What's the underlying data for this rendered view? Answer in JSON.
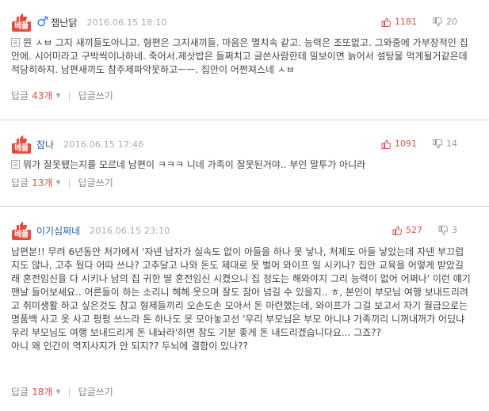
{
  "best_label": "베플",
  "comments": [
    {
      "gender_symbol": "♂",
      "nickname": "잼난닭",
      "date": "2016.06.15 18:10",
      "up": "1181",
      "down": "20",
      "text": "뭔 ㅅㅂ 그지 새끼들도아니고. 형편은 그지새끼들. 마음은 멸치속 같고. 능력은 조또없고. 그와중에 가부장적인 집안에. 시어미라고 구박씩이나하네. 죽어서.제삿밥은 들쩌치고 글쓴사람한테 밀보이면 늙어서 설탕물 먹게될거같은데 적당히하지. 남편새끼도 참주제파악못하고ㅡㅡ. 집안이 어쩐져스네 ㅅㅂ",
      "reply_label": "답글",
      "reply_count": "43개",
      "arrow": "▼",
      "write_label": "답글쓰기",
      "thumb_icon": "thumbs-up-icon",
      "up_icon": "thumbs-up-icon",
      "down_icon": "thumbs-down-icon"
    },
    {
      "nickname": "참나",
      "date": "2016.06.15 17:46",
      "up": "1091",
      "down": "14",
      "text": "뭐가 잘못됐는지를 모르네 남편이 ㅋㅋㅋ 니네 가족이 잘못된거야.. 부인 말투가 아니라",
      "reply_label": "답글",
      "reply_count": "13개",
      "arrow": "▼",
      "write_label": "답글쓰기"
    },
    {
      "nickname": "이기심쩌네",
      "date": "2016.06.15 23:10",
      "up": "527",
      "down": "3",
      "text": "남편분!! 무려 6년동안 처가에서 '자넨 남자가 실속도 없이 아들을 하나 못 낳나, 처제도 아들 낳았는데 자넨 부끄럽지도 않나, 고추 뒀다 어따 쓰나? 고추달고 나와 돈도 제대로 못 벌어 와이프 일 시키나? 집안 교육을 어떻게 받았길래 혼전임신을 다 시키나 남의 집 귀한 딸 혼전임신 시켰으니 집 정도는 해와야지 그리 능력이 없어 어쩌나' 이런 얘기 맨날 들어보세요.. 어른들이 하는 소리니 헤헤 웃으며 잘도 참아 넘길 수 있을지.. ㅎ, 본인이 부모님 여행 보내드리려고 취미생활 하고 싶은것도 참고 형제들끼리 오손도손 모아서 돈 마련했는데, 와이프가 그걸 보고서 자기 월급으로는 명품백 사고 옷 사고 펑펑 쓰느라 돈 하나도 못 모아놓고선 '우리 부모님은 부모 아니냐 가족끼리 니꺼내꺼가 어딨냐 우리 부모님도 여행 보내드리게 돈 내놔라'하면 참도 기분 좋게 돈 내드리겠습니다요... 그죠??\n아니 왜 인간이 역지사지가 안 되지?? 두뇌에 결함이 있나??",
      "reply_label": "답글",
      "reply_count": "18개",
      "arrow": "▼",
      "write_label": "답글쓰기"
    }
  ]
}
